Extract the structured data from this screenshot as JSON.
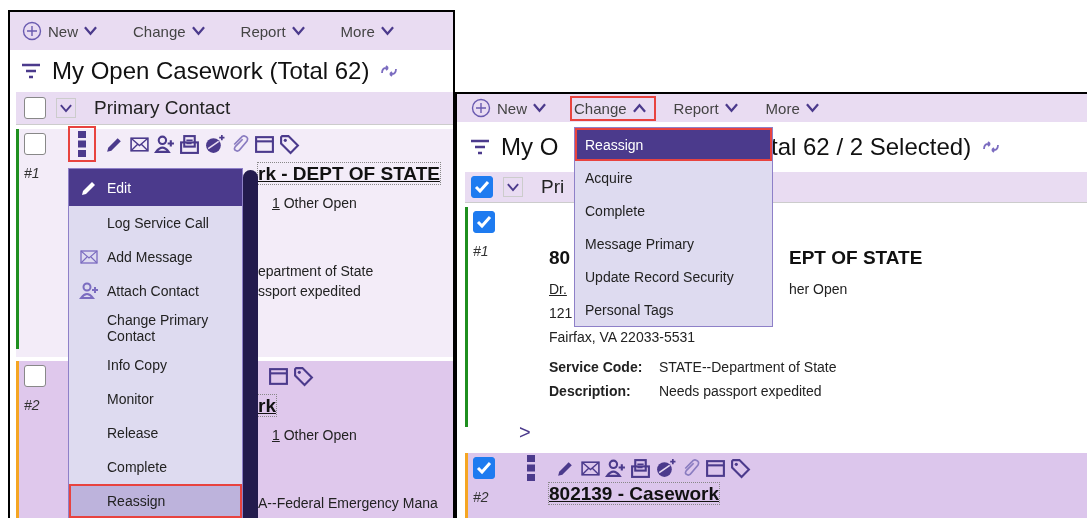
{
  "left_panel": {
    "toolbar": [
      {
        "label": "New",
        "kind": "new",
        "open": false,
        "callout": false
      },
      {
        "label": "Change",
        "kind": "menu",
        "open": false,
        "callout": false
      },
      {
        "label": "Report",
        "kind": "menu",
        "open": false,
        "callout": false
      },
      {
        "label": "More",
        "kind": "menu",
        "open": false,
        "callout": false
      }
    ],
    "title_parts": [
      "My Open Casework (Total 62)"
    ],
    "header": {
      "checked": false,
      "label": "Primary Contact"
    },
    "cards": [
      {
        "number": "#1",
        "checked": false,
        "color": "#1f8f1f",
        "kebab_shown": true,
        "leading_icons_shown": true,
        "trailing_icons_shown": true,
        "kebab_callout": true,
        "lines": [
          {
            "kind": "title",
            "parts": [
              "rk - DEPT OF STATE"
            ]
          },
          {
            "kind": "other_open",
            "count": "1",
            "label": "Other Open"
          },
          {
            "kind": "plain",
            "parts": [
              "epartment of State"
            ]
          },
          {
            "kind": "plain",
            "parts": [
              "ssport expedited"
            ]
          }
        ]
      },
      {
        "number": "#2",
        "checked": false,
        "color": "#f5a623",
        "kebab_shown": false,
        "leading_icons_shown": false,
        "trailing_icons_shown": true,
        "lines": [
          {
            "kind": "title",
            "parts": [
              "rk"
            ]
          },
          {
            "kind": "other_open",
            "count": "1",
            "label": "Other Open"
          },
          {
            "kind": "plain",
            "parts": [
              "A--Federal Emergency Mana"
            ]
          }
        ]
      }
    ],
    "menu": {
      "items": [
        {
          "label": "Edit",
          "kind": "edit",
          "active": true,
          "hovered": false,
          "callout": false
        },
        {
          "label": "Log Service Call",
          "kind": "plain",
          "active": false,
          "hovered": false,
          "callout": false
        },
        {
          "label": "Add Message",
          "kind": "message",
          "active": false,
          "hovered": false,
          "callout": false
        },
        {
          "label": "Attach Contact",
          "kind": "contact",
          "active": false,
          "hovered": false,
          "callout": false
        },
        {
          "label": "Change Primary Contact",
          "kind": "plain",
          "active": false,
          "hovered": false,
          "callout": false
        },
        {
          "label": "Info Copy",
          "kind": "plain",
          "active": false,
          "hovered": false,
          "callout": false
        },
        {
          "label": "Monitor",
          "kind": "plain",
          "active": false,
          "hovered": false,
          "callout": false
        },
        {
          "label": "Release",
          "kind": "plain",
          "active": false,
          "hovered": false,
          "callout": false
        },
        {
          "label": "Complete",
          "kind": "plain",
          "active": false,
          "hovered": false,
          "callout": false
        },
        {
          "label": "Reassign",
          "kind": "plain",
          "active": false,
          "hovered": true,
          "callout": true
        }
      ]
    }
  },
  "right_panel": {
    "toolbar": [
      {
        "label": "New",
        "kind": "new",
        "open": false,
        "callout": false
      },
      {
        "label": "Change",
        "kind": "menu",
        "open": true,
        "callout": true
      },
      {
        "label": "Report",
        "kind": "menu",
        "open": false,
        "callout": false
      },
      {
        "label": "More",
        "kind": "menu",
        "open": false,
        "callout": false
      }
    ],
    "title_parts": [
      "My O",
      "tal 62 / 2 Selected)"
    ],
    "header": {
      "checked": true,
      "label": "Pri"
    },
    "cards": [
      {
        "number": "#1",
        "checked": true,
        "color": "#1f8f1f",
        "kebab_shown": false,
        "leading_icons_shown": false,
        "trailing_icons_shown": false,
        "expand": ">",
        "lines": [
          {
            "kind": "title",
            "parts": [
              "80",
              "EPT OF STATE"
            ]
          },
          {
            "kind": "contact",
            "parts": [
              "Dr.",
              "her Open"
            ]
          },
          {
            "kind": "plain",
            "parts": [
              "121"
            ]
          },
          {
            "kind": "plain",
            "parts": [
              "Fairfax, VA 22033-5531"
            ]
          },
          {
            "kind": "field",
            "label": "Service Code:",
            "value": "STATE--Department of State"
          },
          {
            "kind": "field",
            "label": "Description:",
            "value": "Needs passport expedited"
          }
        ]
      },
      {
        "number": "#2",
        "checked": true,
        "color": "#f5a623",
        "kebab_shown": true,
        "leading_icons_shown": true,
        "trailing_icons_shown": true,
        "kebab_callout": false,
        "lines": [
          {
            "kind": "title",
            "parts": [
              "802139 - Casework"
            ]
          }
        ]
      }
    ],
    "menu": {
      "items": [
        {
          "label": "Reassign",
          "active": true,
          "hovered": false,
          "callout": true
        },
        {
          "label": "Acquire",
          "active": false,
          "hovered": false,
          "callout": false
        },
        {
          "label": "Complete",
          "active": false,
          "hovered": false,
          "callout": false
        },
        {
          "label": "Message Primary",
          "active": false,
          "hovered": false,
          "callout": false
        },
        {
          "label": "Update Record Security",
          "active": false,
          "hovered": false,
          "callout": false
        },
        {
          "label": "Personal Tags",
          "active": false,
          "hovered": false,
          "callout": false
        }
      ]
    }
  }
}
